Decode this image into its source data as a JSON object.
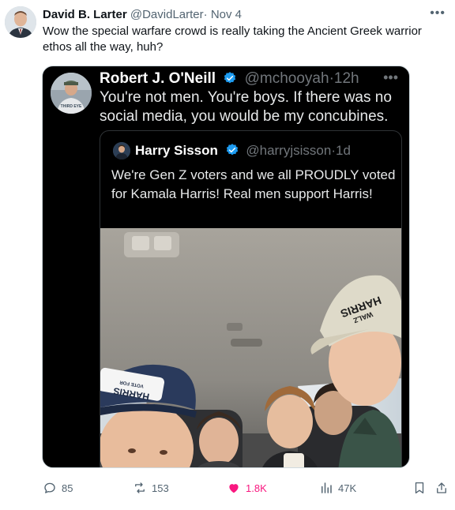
{
  "outer_tweet": {
    "display_name": "David B. Larter",
    "handle": "@DavidLarter",
    "separator": "·",
    "date": "Nov 4",
    "text": "Wow the special warfare crowd is really taking the Ancient Greek warrior ethos all the way, huh?"
  },
  "embedded_tweet": {
    "display_name": "Robert J. O'Neill",
    "handle": "@mchooyah",
    "separator": "·",
    "time": "12h",
    "text": "You're not men. You're boys. If there was no social media, you would be my concubines.",
    "avatar_shirt_text": "THIRD EYE",
    "quoted": {
      "display_name": "Harry Sisson",
      "handle": "@harryjsisson",
      "separator": "·",
      "time": "1d",
      "text": "We're Gen Z voters and we all PROUDLY voted for Kamala Harris! Real men support Harris!",
      "cap_right_text_1": "HARRIS",
      "cap_right_text_2": "WALZ",
      "cap_left_text_1": "HARRIS",
      "cap_left_text_2": "VOTE FOR"
    }
  },
  "actions": {
    "replies": "85",
    "reposts": "153",
    "likes": "1.8K",
    "views": "47K"
  },
  "colors": {
    "like": "#f91880",
    "verified": "#1d9bf0",
    "muted": "#536471"
  }
}
